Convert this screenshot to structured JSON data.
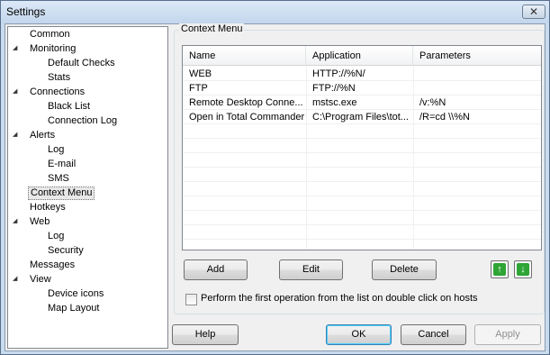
{
  "window": {
    "title": "Settings"
  },
  "sidebar": {
    "items": [
      {
        "label": "Common",
        "level": 0,
        "expander": false
      },
      {
        "label": "Monitoring",
        "level": 0,
        "expander": true
      },
      {
        "label": "Default Checks",
        "level": 1
      },
      {
        "label": "Stats",
        "level": 1
      },
      {
        "label": "Connections",
        "level": 0,
        "expander": true
      },
      {
        "label": "Black List",
        "level": 1
      },
      {
        "label": "Connection Log",
        "level": 1
      },
      {
        "label": "Alerts",
        "level": 0,
        "expander": true
      },
      {
        "label": "Log",
        "level": 1
      },
      {
        "label": "E-mail",
        "level": 1
      },
      {
        "label": "SMS",
        "level": 1
      },
      {
        "label": "Context Menu",
        "level": 0,
        "selected": true
      },
      {
        "label": "Hotkeys",
        "level": 0
      },
      {
        "label": "Web",
        "level": 0,
        "expander": true
      },
      {
        "label": "Log",
        "level": 1
      },
      {
        "label": "Security",
        "level": 1
      },
      {
        "label": "Messages",
        "level": 0
      },
      {
        "label": "View",
        "level": 0,
        "expander": true
      },
      {
        "label": "Device icons",
        "level": 1
      },
      {
        "label": "Map Layout",
        "level": 1
      }
    ]
  },
  "context_menu": {
    "group_title": "Context Menu",
    "columns": [
      "Name",
      "Application",
      "Parameters"
    ],
    "rows": [
      {
        "name": "WEB",
        "application": "HTTP://%N/",
        "parameters": ""
      },
      {
        "name": "FTP",
        "application": "FTP://%N",
        "parameters": ""
      },
      {
        "name": "Remote Desktop Conne...",
        "application": "mstsc.exe",
        "parameters": "/v:%N"
      },
      {
        "name": "Open in Total Commander",
        "application": "C:\\Program Files\\tot...",
        "parameters": "/R=cd \\\\%N"
      }
    ],
    "add_label": "Add",
    "edit_label": "Edit",
    "delete_label": "Delete",
    "double_click_option": "Perform the first operation from the list on double click on hosts",
    "double_click_checked": false
  },
  "footer": {
    "help_label": "Help",
    "ok_label": "OK",
    "cancel_label": "Cancel",
    "apply_label": "Apply"
  }
}
